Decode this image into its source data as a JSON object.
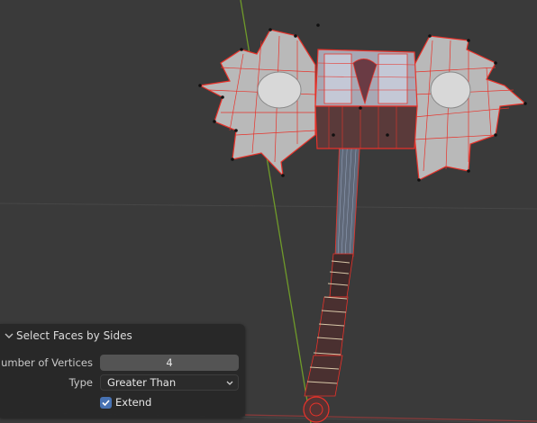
{
  "colors": {
    "background": "#3a3a3a",
    "grid_line": "#474747",
    "y_axis": "#6f9a2a",
    "x_axis": "#8a3a3a",
    "selection": "#e8322a",
    "panel": "#282828",
    "accent": "#4772b3"
  },
  "viewport": {
    "object": "axe-mesh-in-edit-mode"
  },
  "operator_panel": {
    "title": "Select Faces by Sides",
    "number_of_vertices": {
      "label": "Number of Vertices",
      "value": "4"
    },
    "type": {
      "label": "Type",
      "value": "Greater Than"
    },
    "extend": {
      "label": "Extend",
      "checked": true
    }
  },
  "icons": {
    "collapse": "chevron-down-icon",
    "dropdown": "chevron-down-icon",
    "check": "checkmark-icon"
  }
}
